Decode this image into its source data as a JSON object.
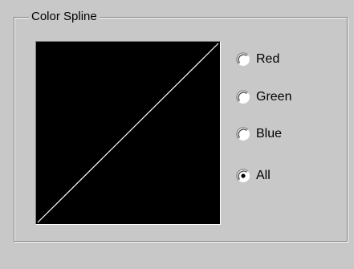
{
  "group": {
    "title": "Color Spline"
  },
  "spline": {
    "background": "#000000",
    "curve_color": "#ffffff",
    "curve": "linear"
  },
  "channels": {
    "selected": "All",
    "options": [
      {
        "label": "Red",
        "checked": false
      },
      {
        "label": "Green",
        "checked": false
      },
      {
        "label": "Blue",
        "checked": false
      },
      {
        "label": "All",
        "checked": true
      }
    ]
  }
}
